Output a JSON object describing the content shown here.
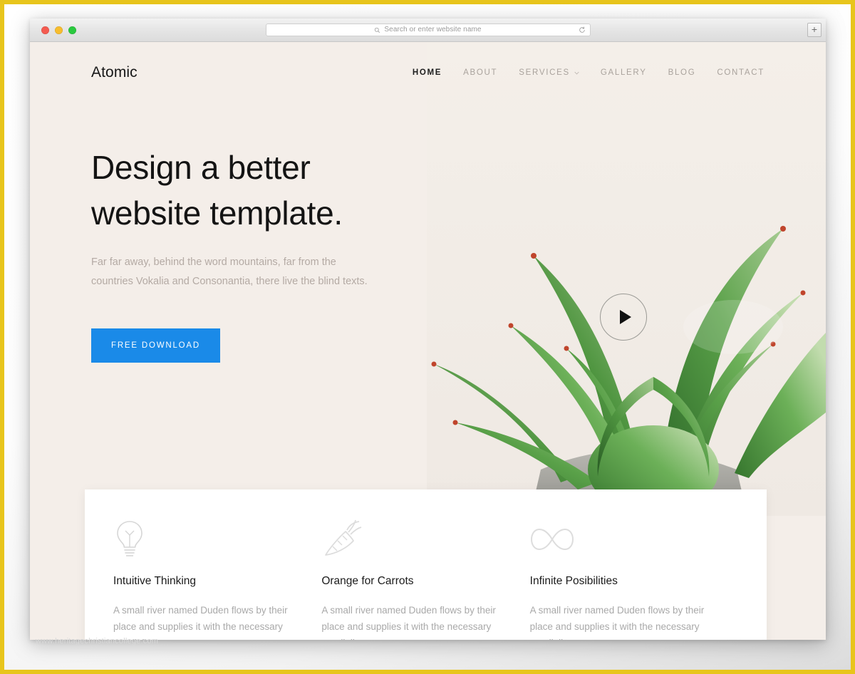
{
  "browser": {
    "traffic_lights": [
      "close",
      "minimize",
      "maximize"
    ],
    "address_placeholder": "Search or enter website name",
    "address_value": "",
    "reload_label": "",
    "new_tab_label": "+"
  },
  "site": {
    "logo": "Atomic",
    "nav": [
      {
        "label": "HOME",
        "active": true,
        "has_dropdown": false
      },
      {
        "label": "ABOUT",
        "active": false,
        "has_dropdown": false
      },
      {
        "label": "SERVICES",
        "active": false,
        "has_dropdown": true
      },
      {
        "label": "GALLERY",
        "active": false,
        "has_dropdown": false
      },
      {
        "label": "BLOG",
        "active": false,
        "has_dropdown": false
      },
      {
        "label": "CONTACT",
        "active": false,
        "has_dropdown": false
      }
    ],
    "hero": {
      "title_line_1": "Design a better",
      "title_line_2": "website template.",
      "subtitle_line_1": "Far far away, behind the word mountains, far from the",
      "subtitle_line_2": "countries Vokalia and Consonantia, there live the blind texts.",
      "cta_label": "FREE DOWNLOAD",
      "play_label": "play-video"
    },
    "features": [
      {
        "icon": "lightbulb-icon",
        "title": "Intuitive Thinking",
        "text": "A small river named Duden flows by their place and supplies it with the necessary regelialia."
      },
      {
        "icon": "carrot-icon",
        "title": "Orange for Carrots",
        "text": "A small river named Duden flows by their place and supplies it with the necessary regelialia."
      },
      {
        "icon": "infinity-icon",
        "title": "Infinite Posibilities",
        "text": "A small river named Duden flows by their place and supplies it with the necessary regelialia."
      }
    ]
  },
  "watermark": "www.heritagechristiancollege.com",
  "colors": {
    "frame": "#e8c51c",
    "hero_background": "#f4eee9",
    "cta_blue": "#1a8ae8",
    "nav_inactive": "#a9a29c",
    "nav_active": "#1d1d1d",
    "card_background": "#ffffff"
  }
}
